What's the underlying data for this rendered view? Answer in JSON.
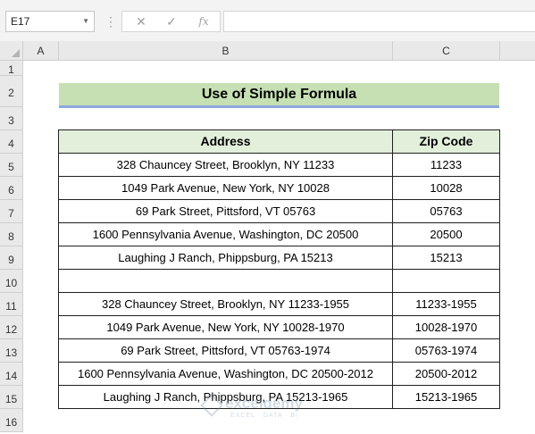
{
  "formula_bar": {
    "name_box": "E17",
    "cancel_icon": "✕",
    "enter_icon": "✓",
    "fx_label": "fx",
    "formula_value": ""
  },
  "columns": [
    "A",
    "B",
    "C"
  ],
  "rows": [
    "1",
    "2",
    "3",
    "4",
    "5",
    "6",
    "7",
    "8",
    "9",
    "10",
    "11",
    "12",
    "13",
    "14",
    "15",
    "16"
  ],
  "sheet": {
    "title": "Use of Simple Formula",
    "headers": {
      "address": "Address",
      "zip": "Zip Code"
    },
    "data_rows": [
      {
        "address": "328 Chauncey Street, Brooklyn, NY 11233",
        "zip": "11233"
      },
      {
        "address": "1049 Park Avenue, New York, NY 10028",
        "zip": "10028"
      },
      {
        "address": "69 Park Street, Pittsford, VT 05763",
        "zip": "05763"
      },
      {
        "address": "1600 Pennsylvania Avenue, Washington, DC 20500",
        "zip": "20500"
      },
      {
        "address": "Laughing J Ranch, Phippsburg, PA 15213",
        "zip": "15213"
      },
      {
        "address": "",
        "zip": ""
      },
      {
        "address": "328 Chauncey Street, Brooklyn, NY 11233-1955",
        "zip": "11233-1955"
      },
      {
        "address": "1049 Park Avenue, New York, NY 10028-1970",
        "zip": "10028-1970"
      },
      {
        "address": "69 Park Street, Pittsford, VT 05763-1974",
        "zip": "05763-1974"
      },
      {
        "address": "1600 Pennsylvania Avenue, Washington, DC 20500-2012",
        "zip": "20500-2012"
      },
      {
        "address": "Laughing J Ranch, Phippsburg, PA 15213-1965",
        "zip": "15213-1965"
      }
    ]
  },
  "watermark": {
    "name": "exceldemy",
    "tagline": "EXCEL · DATA · BI"
  },
  "colors": {
    "title_fill": "#c6e0b4",
    "header_fill": "#e2efda",
    "title_underline": "#8ea9db"
  }
}
